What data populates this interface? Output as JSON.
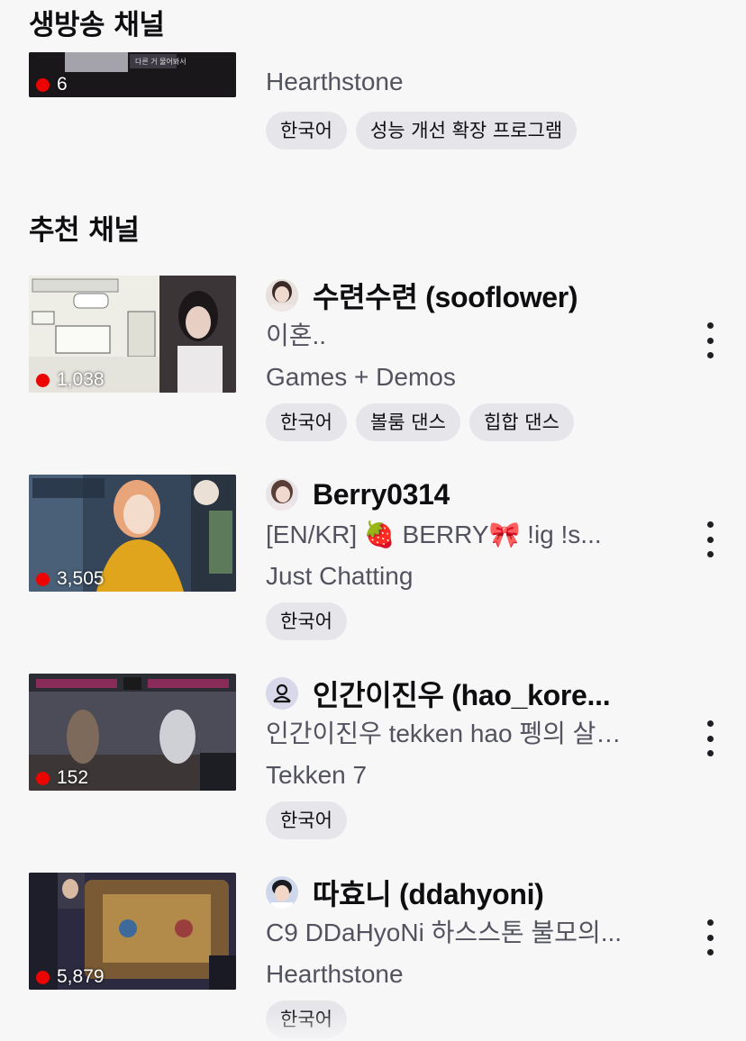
{
  "sections": {
    "live": "생방송 채널",
    "recommended": "추천 채널"
  },
  "top_card": {
    "viewers": "6",
    "category": "Hearthstone",
    "tags": [
      "한국어",
      "성능 개선 확장 프로그램"
    ],
    "thumb_caption": "다른 거 물어봐서"
  },
  "channels": [
    {
      "name": "수련수련 (sooflower)",
      "title": "이혼..",
      "category": "Games + Demos",
      "viewers": "1,038",
      "tags": [
        "한국어",
        "볼룸 댄스",
        "힙합 댄스"
      ]
    },
    {
      "name": "Berry0314",
      "title": "[EN/KR]  🍓 BERRY🎀  !ig !s...",
      "category": "Just Chatting",
      "viewers": "3,505",
      "tags": [
        "한국어"
      ]
    },
    {
      "name": "인간이진우 (hao_kore...",
      "title": "인간이진우 tekken hao 펭의 살…",
      "category": "Tekken 7",
      "viewers": "152",
      "tags": [
        "한국어"
      ]
    },
    {
      "name": "따효니 (ddahyoni)",
      "title": "C9 DDaHyoNi 하스스톤 불모의...",
      "category": "Hearthstone",
      "viewers": "5,879",
      "tags": [
        "한국어"
      ]
    }
  ],
  "colors": {
    "live_dot": "#eb0400",
    "tag_bg": "#e6e6ea",
    "secondary_text": "#53535f",
    "background": "#f7f7f8"
  },
  "icons": {
    "more": "more-vertical-icon",
    "live": "live-dot-icon"
  }
}
